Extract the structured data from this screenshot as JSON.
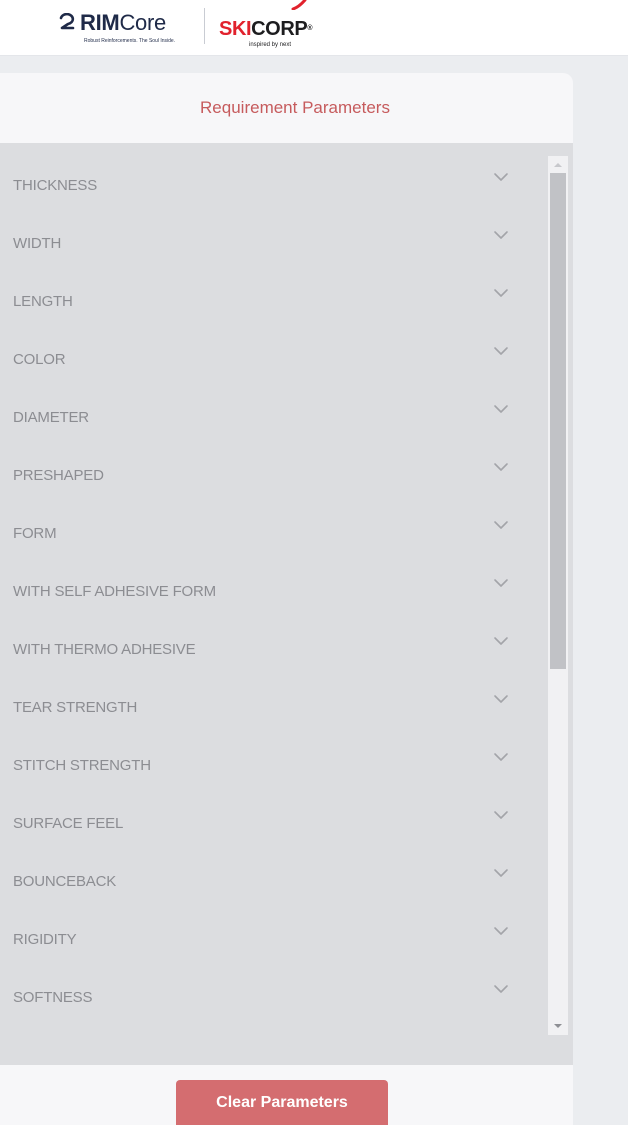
{
  "header": {
    "rim_logo": {
      "brand_bold": "RIM",
      "brand_light": "Core",
      "tagline": "Robust Reinforcements. The Soul Inside."
    },
    "skicorp_logo": {
      "brand_red": "SKI",
      "brand_dark": "CORP",
      "registered": "®",
      "tagline": "inspired by next"
    }
  },
  "panel": {
    "title": "Requirement Parameters",
    "parameters": [
      {
        "label": "THICKNESS",
        "icon": "chevron-down-icon"
      },
      {
        "label": "WIDTH",
        "icon": "chevron-down-icon"
      },
      {
        "label": "LENGTH",
        "icon": "chevron-down-icon"
      },
      {
        "label": "COLOR",
        "icon": "chevron-down-icon"
      },
      {
        "label": "DIAMETER",
        "icon": "chevron-down-icon"
      },
      {
        "label": "PRESHAPED",
        "icon": "chevron-down-icon"
      },
      {
        "label": "FORM",
        "icon": "chevron-down-icon"
      },
      {
        "label": "WITH SELF ADHESIVE FORM",
        "icon": "chevron-down-icon"
      },
      {
        "label": "WITH THERMO ADHESIVE",
        "icon": "chevron-down-icon"
      },
      {
        "label": "TEAR STRENGTH",
        "icon": "chevron-down-icon"
      },
      {
        "label": "STITCH STRENGTH",
        "icon": "chevron-down-icon"
      },
      {
        "label": "SURFACE FEEL",
        "icon": "chevron-down-icon"
      },
      {
        "label": "BOUNCEBACK",
        "icon": "chevron-down-icon"
      },
      {
        "label": "RIGIDITY",
        "icon": "chevron-down-icon"
      },
      {
        "label": "SOFTNESS",
        "icon": "chevron-down-icon"
      }
    ],
    "clear_button": "Clear Parameters"
  },
  "colors": {
    "accent": "#c65b5d",
    "button": "#d46d70",
    "list_background": "#dcdde0",
    "label_text": "#8c8d92",
    "skicorp_red": "#e1222d"
  }
}
